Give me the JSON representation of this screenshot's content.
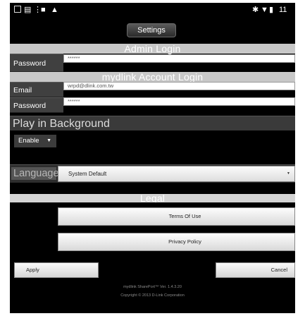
{
  "status_bar": {
    "left_icons": [
      "window-icon",
      "notification-icon",
      "menu-icon",
      "image-icon",
      "android-icon"
    ],
    "right_icons": [
      "bluetooth-icon",
      "wifi-icon",
      "battery-icon"
    ],
    "time": "11"
  },
  "title": "Settings",
  "admin_login": {
    "section_title": "Admin Login",
    "password_label": "Password",
    "password_value": "******"
  },
  "mydlink_login": {
    "section_title": "mydlink Account Login",
    "email_label": "Email",
    "email_value": "wrpd@dlink.com.tw",
    "password_label": "Password",
    "password_value": "******"
  },
  "play_background": {
    "header": "Play in Background",
    "enable_label": "Enable"
  },
  "language": {
    "header": "Language",
    "selected": "System Default"
  },
  "legal": {
    "header": "Legal",
    "terms_label": "Terms Of Use",
    "privacy_label": "Privacy Policy"
  },
  "actions": {
    "apply_label": "Apply",
    "cancel_label": "Cancel"
  },
  "footer": {
    "version": "mydlink SharePort™ Ver. 1.4.3.20",
    "copyright": "Copyright © 2013 D-Link Corporation"
  }
}
